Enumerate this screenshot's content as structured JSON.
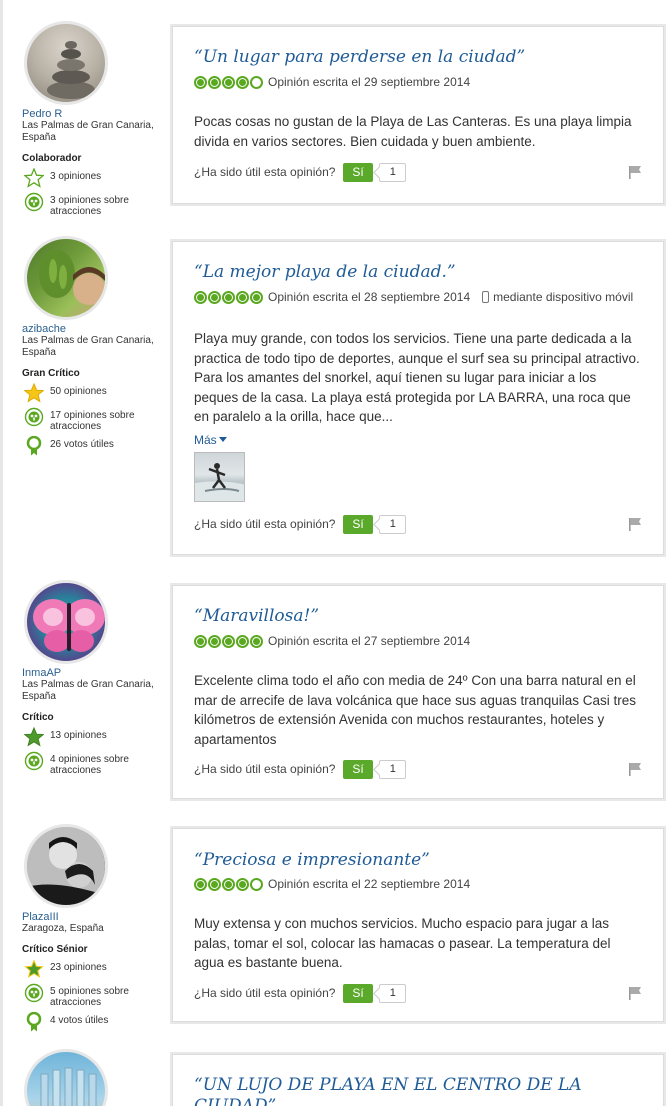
{
  "helpful_question": "¿Ha sido útil esta opinión?",
  "yes_label": "Sí",
  "more_label": "Más",
  "reviews": [
    {
      "username": "Pedro R",
      "location": "Las Palmas de Gran Canaria, España",
      "level": "Colaborador",
      "badges": [
        "3 opiniones",
        "3 opiniones sobre atracciones"
      ],
      "title": "“Un lugar para perderse en la ciudad”",
      "rating": 4,
      "date": "Opinión escrita el 29 septiembre 2014",
      "body": "Pocas cosas no gustan de la Playa de Las Canteras. Es una playa limpia divida en varios sectores. Bien cuidada y buen ambiente.",
      "helpful_count": "1"
    },
    {
      "username": "azibache",
      "location": "Las Palmas de Gran Canaria, España",
      "level": "Gran Crítico",
      "badges": [
        "50 opiniones",
        "17 opiniones sobre atracciones",
        "26 votos útiles"
      ],
      "title": "“La mejor playa de la ciudad.”",
      "rating": 5,
      "date": "Opinión escrita el 28 septiembre 2014",
      "via": "mediante dispositivo móvil",
      "body": "Playa muy grande, con todos los servicios. Tiene una parte dedicada a la practica de todo tipo de deportes, aunque el surf sea su principal atractivo. Para los amantes del snorkel, aquí tienen su lugar para iniciar a los peques de la casa. La playa está protegida por LA BARRA, una roca que en paralelo a la orilla, hace que...",
      "helpful_count": "1"
    },
    {
      "username": "InmaAP",
      "location": "Las Palmas de Gran Canaria, España",
      "level": "Crítico",
      "badges": [
        "13 opiniones",
        "4 opiniones sobre atracciones"
      ],
      "title": "“Maravillosa!”",
      "rating": 5,
      "date": "Opinión escrita el 27 septiembre 2014",
      "body": "Excelente clima todo el año con media de 24º Con una barra natural en el mar de arrecife de lava volcánica que hace sus aguas tranquilas Casi tres kilómetros de extensión Avenida con muchos restaurantes, hoteles y apartamentos",
      "helpful_count": "1"
    },
    {
      "username": "PlazaIII",
      "location": "Zaragoza, España",
      "level": "Crítico Sénior",
      "badges": [
        "23 opiniones",
        "5 opiniones sobre atracciones",
        "4 votos útiles"
      ],
      "title": "“Preciosa e impresionante”",
      "rating": 4,
      "date": "Opinión escrita el 22 septiembre 2014",
      "body": "Muy extensa y con muchos servicios. Mucho espacio para jugar a las palas, tomar el sol, colocar las hamacas o pasear. La temperatura del agua es bastante buena.",
      "helpful_count": "1"
    },
    {
      "title": "“UN LUJO DE PLAYA EN EL CENTRO DE LA CIUDAD”"
    }
  ]
}
